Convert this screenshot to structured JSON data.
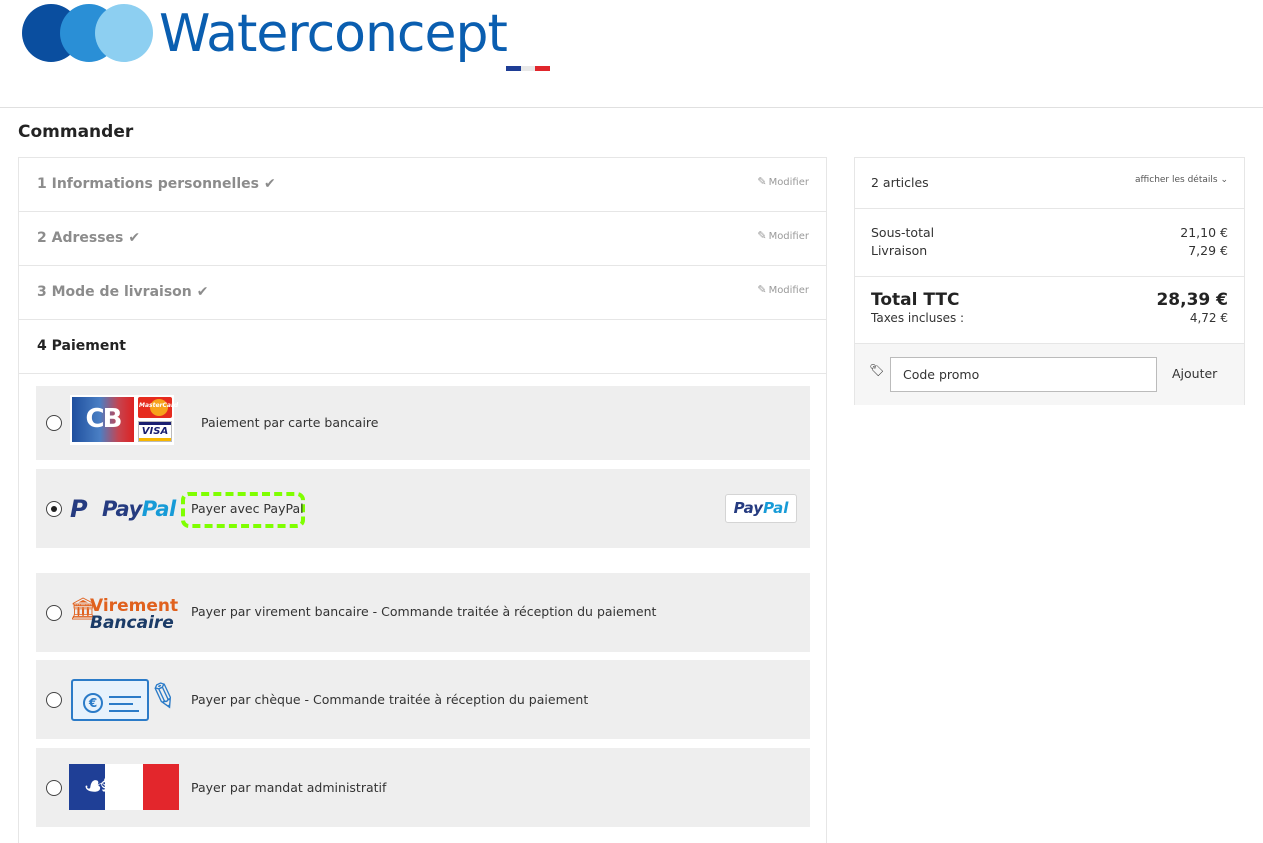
{
  "header": {
    "logo_text": "Waterconcept"
  },
  "page": {
    "title": "Commander"
  },
  "steps": [
    {
      "label": "1 Informations personnelles",
      "edit": "Modifier",
      "done": true
    },
    {
      "label": "2 Adresses",
      "edit": "Modifier",
      "done": true
    },
    {
      "label": "3 Mode de livraison",
      "edit": "Modifier",
      "done": true
    },
    {
      "label": "4 Paiement",
      "current": true
    }
  ],
  "payment": {
    "selected": "paypal",
    "options": [
      {
        "id": "cb",
        "label": "Paiement par carte bancaire",
        "logo_texts": [
          "CB",
          "MasterCard",
          "VISA"
        ]
      },
      {
        "id": "paypal",
        "label": "Payer avec PayPal",
        "logo_word_1": "Pay",
        "logo_word_2": "Pal",
        "button_word_1": "Pay",
        "button_word_2": "Pal"
      },
      {
        "id": "virement",
        "label": "Payer par virement bancaire - Commande traitée à réception du paiement",
        "logo_line_1": "Virement",
        "logo_line_2": "Bancaire"
      },
      {
        "id": "cheque",
        "label": "Payer par chèque - Commande traitée à réception du paiement"
      },
      {
        "id": "mandat",
        "label": "Payer par mandat administratif"
      }
    ]
  },
  "cart": {
    "count_label": "2 articles",
    "details_link": "afficher les détails",
    "subtotal_label": "Sous-total",
    "subtotal_value": "21,10 €",
    "shipping_label": "Livraison",
    "shipping_value": "7,29 €",
    "total_label": "Total TTC",
    "total_value": "28,39 €",
    "tax_label": "Taxes incluses :",
    "tax_value": "4,72 €",
    "promo_placeholder": "Code promo",
    "promo_button": "Ajouter"
  },
  "icons": {
    "check": "checkmark-icon",
    "edit": "pencil-icon",
    "chevron": "chevron-down-icon",
    "tag": "tag-icon"
  },
  "colors": {
    "brand_blue": "#0a5eb0",
    "paypal_dark": "#253b80",
    "paypal_light": "#179bd7",
    "highlight_green": "#7fff00",
    "option_bg": "#eeeeee"
  }
}
